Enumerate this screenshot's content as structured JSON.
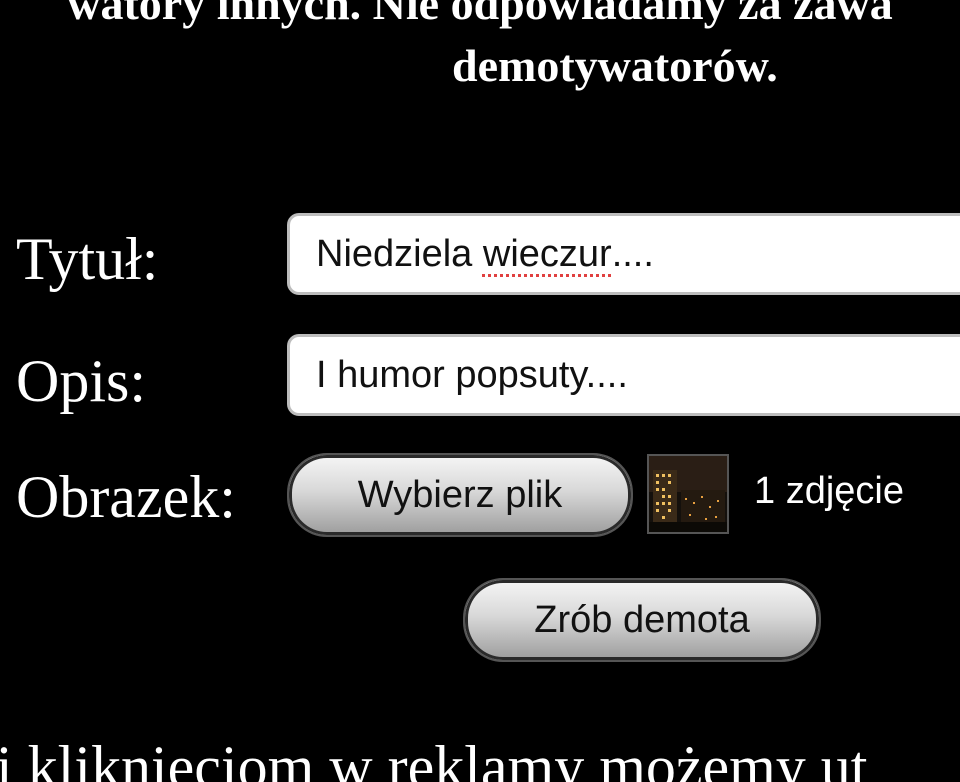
{
  "header": {
    "line1": "watory innych. Nie odpowiadamy za zawa",
    "line2": "demotywatorów."
  },
  "form": {
    "title_label": "Tytuł:",
    "title_value_a": "Niedziela ",
    "title_value_b": "wieczur",
    "title_value_c": "....",
    "desc_label": "Opis:",
    "desc_value": "I humor popsuty....",
    "image_label": "Obrazek:",
    "choose_file_button": "Wybierz plik",
    "thumbnail_icon": "night-city-photo-thumbnail",
    "file_count": "1 zdjęcie",
    "submit_button": "Zrób demota"
  },
  "footer": {
    "line": "i kliknięciom w reklamy możemy ut"
  }
}
